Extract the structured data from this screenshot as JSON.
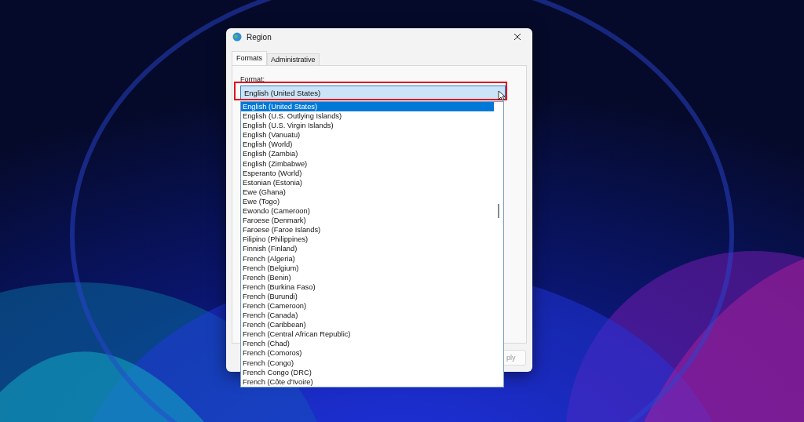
{
  "window": {
    "title": "Region"
  },
  "tabs": [
    {
      "label": "Formats",
      "selected": true
    },
    {
      "label": "Administrative",
      "selected": false
    }
  ],
  "format": {
    "label": "Format:",
    "value": "English (United States)",
    "expanded": true,
    "options": [
      {
        "label": "English (United States)",
        "selected": true
      },
      {
        "label": "English (U.S. Outlying Islands)",
        "selected": false
      },
      {
        "label": "English (U.S. Virgin Islands)",
        "selected": false
      },
      {
        "label": "English (Vanuatu)",
        "selected": false
      },
      {
        "label": "English (World)",
        "selected": false
      },
      {
        "label": "English (Zambia)",
        "selected": false
      },
      {
        "label": "English (Zimbabwe)",
        "selected": false
      },
      {
        "label": "Esperanto (World)",
        "selected": false
      },
      {
        "label": "Estonian (Estonia)",
        "selected": false
      },
      {
        "label": "Ewe (Ghana)",
        "selected": false
      },
      {
        "label": "Ewe (Togo)",
        "selected": false
      },
      {
        "label": "Ewondo (Cameroon)",
        "selected": false
      },
      {
        "label": "Faroese (Denmark)",
        "selected": false
      },
      {
        "label": "Faroese (Faroe Islands)",
        "selected": false
      },
      {
        "label": "Filipino (Philippines)",
        "selected": false
      },
      {
        "label": "Finnish (Finland)",
        "selected": false
      },
      {
        "label": "French (Algeria)",
        "selected": false
      },
      {
        "label": "French (Belgium)",
        "selected": false
      },
      {
        "label": "French (Benin)",
        "selected": false
      },
      {
        "label": "French (Burkina Faso)",
        "selected": false
      },
      {
        "label": "French (Burundi)",
        "selected": false
      },
      {
        "label": "French (Cameroon)",
        "selected": false
      },
      {
        "label": "French (Canada)",
        "selected": false
      },
      {
        "label": "French (Caribbean)",
        "selected": false
      },
      {
        "label": "French (Central African Republic)",
        "selected": false
      },
      {
        "label": "French (Chad)",
        "selected": false
      },
      {
        "label": "French (Comoros)",
        "selected": false
      },
      {
        "label": "French (Congo)",
        "selected": false
      },
      {
        "label": "French Congo (DRC)",
        "selected": false
      },
      {
        "label": "French (Côte d'Ivoire)",
        "selected": false
      }
    ]
  },
  "buttons": [
    "ply"
  ]
}
